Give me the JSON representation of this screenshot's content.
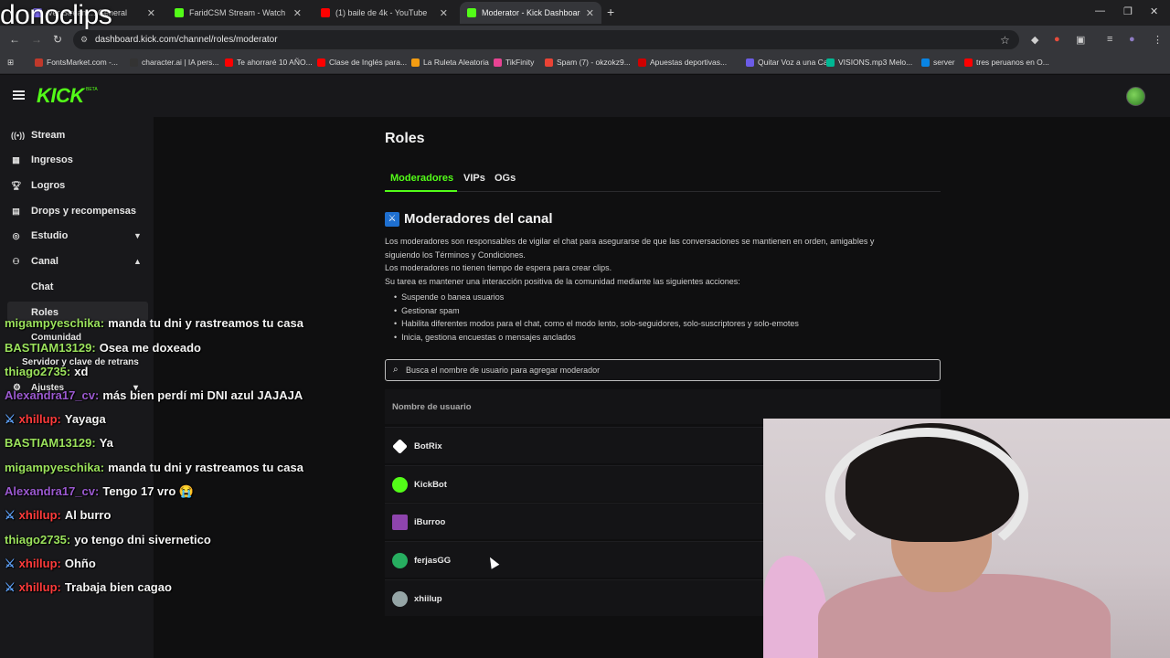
{
  "watermark": "donoclips",
  "browser": {
    "tabs": [
      {
        "title": "Ver Stream... General",
        "color": "#7b68ee"
      },
      {
        "title": "FaridCSM Stream - Watch Live",
        "color": "#53fc18"
      },
      {
        "title": "(1) baile de 4k - YouTube",
        "color": "#ff0000"
      },
      {
        "title": "Moderator - Kick Dashboard",
        "color": "#53fc18"
      }
    ],
    "url": "dashboard.kick.com/channel/roles/moderator",
    "bookmarks": [
      {
        "label": "FontsMarket.com -...",
        "color": "#c0392b"
      },
      {
        "label": "character.ai | IA pers...",
        "color": "#333333"
      },
      {
        "label": "Te ahorraré 10 AÑO...",
        "color": "#ff0000"
      },
      {
        "label": "Clase de Inglés para...",
        "color": "#ff0000"
      },
      {
        "label": "La Ruleta Aleatoria",
        "color": "#f39c12"
      },
      {
        "label": "TikFinity",
        "color": "#e84393"
      },
      {
        "label": "Spam (7) - okzokz9...",
        "color": "#ea4335"
      },
      {
        "label": "Apuestas deportivas...",
        "color": "#d00000"
      },
      {
        "label": "Quitar Voz a una Ca...",
        "color": "#6c5ce7"
      },
      {
        "label": "VISIONS.mp3 Melo...",
        "color": "#00b894"
      },
      {
        "label": "server",
        "color": "#0984e3"
      },
      {
        "label": "tres peruanos en O...",
        "color": "#ff0000"
      }
    ]
  },
  "kick": {
    "logo": "KICK",
    "beta": "BETA",
    "sidebar": {
      "items": [
        {
          "label": "Stream",
          "icon": "broadcast-icon"
        },
        {
          "label": "Ingresos",
          "icon": "revenue-icon"
        },
        {
          "label": "Logros",
          "icon": "trophy-icon"
        },
        {
          "label": "Drops y recompensas",
          "icon": "gift-icon"
        },
        {
          "label": "Estudio",
          "icon": "studio-icon"
        },
        {
          "label": "Canal",
          "icon": "channel-icon"
        }
      ],
      "subitems": [
        "Chat",
        "Roles"
      ],
      "ghost": {
        "comunidad": "Comunidad",
        "servidor": "Servidor y clave de retrans",
        "ajustes": "Ajustes"
      }
    },
    "page_title": "Roles",
    "tabs": [
      "Moderadores",
      "VIPs",
      "OGs"
    ],
    "section_title": "Moderadores del canal",
    "description": [
      "Los moderadores son responsables de vigilar el chat para asegurarse de que las conversaciones se mantienen en orden, amigables y",
      "siguiendo los Términos y Condiciones.",
      "Los moderadores no tienen tiempo de espera para crear clips.",
      "Su tarea es mantener una interacción positiva de la comunidad mediante las siguientes acciones:"
    ],
    "bullets": [
      "Suspende o banea usuarios",
      "Gestionar spam",
      "Habilita diferentes modos para el chat, como el modo lento, solo-seguidores, solo-suscriptores y solo-emotes",
      "Inicia, gestiona encuestas o mensajes anclados"
    ],
    "search_placeholder": "Busca el nombre de usuario para agregar moderador",
    "table_header": "Nombre de usuario",
    "moderators": [
      {
        "name": "BotRix",
        "color": "#ffffff"
      },
      {
        "name": "KickBot",
        "color": "#53fc18"
      },
      {
        "name": "iBurroo",
        "color": "#8e44ad"
      },
      {
        "name": "ferjasGG",
        "color": "#27ae60"
      },
      {
        "name": "xhiilup",
        "color": "#95a5a6"
      }
    ]
  },
  "chat": [
    {
      "user": "migampyeschika:",
      "user_color": "#9be25c",
      "text": "manda tu dni y rastreamos tu casa",
      "badge": ""
    },
    {
      "user": "BASTIAM13129:",
      "user_color": "#9be25c",
      "text": "Osea me doxeado",
      "badge": ""
    },
    {
      "user": "thiago2735:",
      "user_color": "#9be25c",
      "text": "xd",
      "badge": ""
    },
    {
      "user": "Alexandra17_cv:",
      "user_color": "#9b59d0",
      "text": "más bien perdí mi DNI azul JAJAJA",
      "badge": ""
    },
    {
      "user": "xhillup:",
      "user_color": "#ff3b3b",
      "text": "Yayaga",
      "badge": "⚔"
    },
    {
      "user": "BASTIAM13129:",
      "user_color": "#9be25c",
      "text": "Ya",
      "badge": ""
    },
    {
      "user": "migampyeschika:",
      "user_color": "#9be25c",
      "text": "manda tu dni y rastreamos tu casa",
      "badge": ""
    },
    {
      "user": "Alexandra17_cv:",
      "user_color": "#9b59d0",
      "text": "Tengo 17 vro 😭",
      "badge": ""
    },
    {
      "user": "xhillup:",
      "user_color": "#ff3b3b",
      "text": "Al burro",
      "badge": "⚔"
    },
    {
      "user": "thiago2735:",
      "user_color": "#9be25c",
      "text": "yo tengo dni sivernetico",
      "badge": ""
    },
    {
      "user": "xhillup:",
      "user_color": "#ff3b3b",
      "text": "Ohño",
      "badge": "⚔"
    },
    {
      "user": "xhillup:",
      "user_color": "#ff3b3b",
      "text": "Trabaja bien cagao",
      "badge": "⚔"
    }
  ]
}
